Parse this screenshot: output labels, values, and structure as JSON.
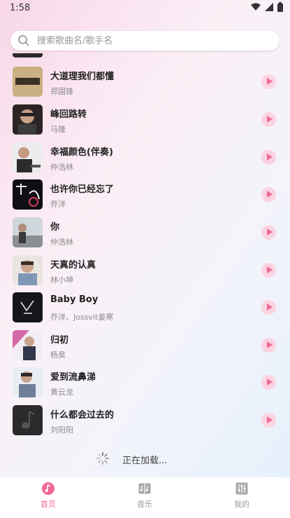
{
  "status_bar": {
    "time": "1:58"
  },
  "search": {
    "placeholder": "搜索歌曲名/歌手名"
  },
  "songs": [
    {
      "title": "大道理我们都懂",
      "artist": "郑国锋"
    },
    {
      "title": "峰回路转",
      "artist": "马隆"
    },
    {
      "title": "幸福颜色(伴奏)",
      "artist": "仲浩林"
    },
    {
      "title": "也许你已经忘了",
      "artist": "乔洋"
    },
    {
      "title": "你",
      "artist": "仲浩林"
    },
    {
      "title": "天真的认真",
      "artist": "林小坤"
    },
    {
      "title": "Baby Boy",
      "artist": "乔洋、Jossvit姜寒"
    },
    {
      "title": "归初",
      "artist": "杨昊"
    },
    {
      "title": "爱到流鼻涕",
      "artist": "黄云龙"
    },
    {
      "title": "什么都会过去的",
      "artist": "刘阳阳"
    }
  ],
  "loading": {
    "text": "正在加载..."
  },
  "tabs": [
    {
      "label": "首页",
      "icon": "music-note-icon",
      "active": true
    },
    {
      "label": "音乐",
      "icon": "music-book-icon",
      "active": false
    },
    {
      "label": "我的",
      "icon": "equalizer-icon",
      "active": false
    }
  ],
  "colors": {
    "accent": "#f06a93",
    "play_bg": "#fbd3e1",
    "inactive": "#9a9a9a"
  }
}
